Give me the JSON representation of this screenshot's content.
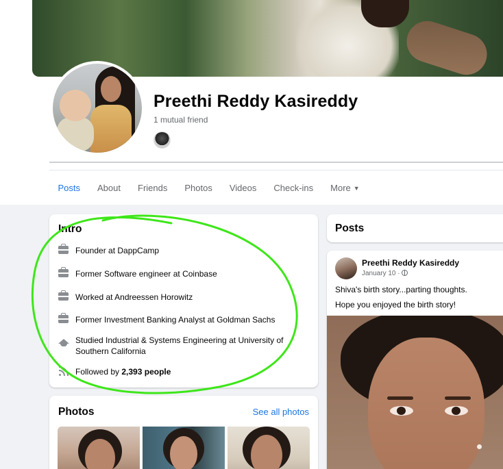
{
  "profile": {
    "name": "Preethi Reddy Kasireddy",
    "mutual_friends": "1 mutual friend"
  },
  "tabs": [
    {
      "label": "Posts",
      "active": true
    },
    {
      "label": "About"
    },
    {
      "label": "Friends"
    },
    {
      "label": "Photos"
    },
    {
      "label": "Videos"
    },
    {
      "label": "Check-ins"
    },
    {
      "label": "More"
    }
  ],
  "intro": {
    "title": "Intro",
    "items": [
      {
        "icon": "briefcase-icon",
        "text": "Founder at DappCamp"
      },
      {
        "icon": "briefcase-icon",
        "text": "Former Software engineer at Coinbase"
      },
      {
        "icon": "briefcase-icon",
        "text": "Worked at Andreessen Horowitz"
      },
      {
        "icon": "briefcase-icon",
        "text": "Former Investment Banking Analyst at Goldman Sachs"
      },
      {
        "icon": "graduation-cap-icon",
        "text": "Studied Industrial & Systems Engineering at University of Southern California"
      }
    ],
    "followers": {
      "icon": "rss-icon",
      "prefix": "Followed by",
      "count": "2,393 people"
    }
  },
  "photos": {
    "title": "Photos",
    "see_all": "See all photos"
  },
  "posts": {
    "title": "Posts",
    "post": {
      "author": "Preethi Reddy Kasireddy",
      "date": "January 10 ·",
      "privacy_icon": "globe-icon",
      "lines": [
        "Shiva's birth story...parting thoughts.",
        "Hope you enjoyed the birth story!"
      ]
    }
  },
  "colors": {
    "accent": "#1b74e4",
    "secondary_text": "#65676b",
    "annotation": "#3ee619",
    "page_bg": "#f0f2f5"
  }
}
